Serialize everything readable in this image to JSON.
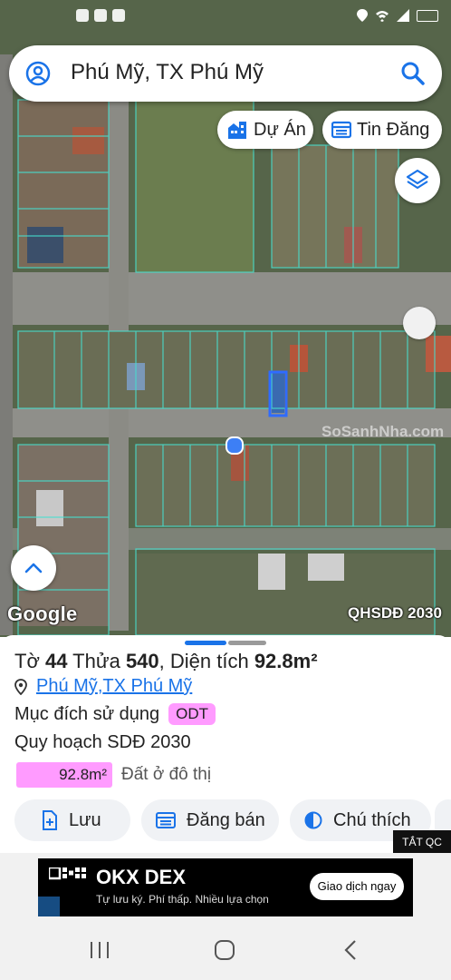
{
  "status_bar": {
    "left_icons": [
      "mail-icon",
      "instagram-icon",
      "cloud-icon",
      "dot-icon"
    ],
    "right_icons": [
      "location-icon",
      "wifi-icon",
      "signal-icon",
      "battery-icon"
    ]
  },
  "search": {
    "query": "Phú Mỹ, TX Phú Mỹ",
    "icon_left": "user-icon",
    "icon_right": "search-icon"
  },
  "chips": [
    {
      "label": "Dự Án",
      "icon": "building-icon"
    },
    {
      "label": "Tin Đăng",
      "icon": "listing-icon"
    }
  ],
  "map": {
    "brand": "Google",
    "plan_label": "QHSDĐ 2030",
    "watermark": "SoSanhNha.com"
  },
  "parcel": {
    "prefix_sheet": "Tờ ",
    "sheet_no": "44",
    "prefix_lot": " Thửa ",
    "lot_no": "540",
    "prefix_area": ", Diện tích ",
    "area": "92.8m²",
    "address_part1": "Phú Mỹ",
    "address_sep": ", ",
    "address_part2": "TX Phú Mỹ",
    "purpose_label": "Mục đích sử dụng",
    "purpose_code": "ODT",
    "plan_title": "Quy hoạch SDĐ 2030",
    "area_value": "92.8m²",
    "area_desc": "Đất ở đô thị",
    "area_color": "#ff9bff"
  },
  "actions": [
    {
      "label": "Lưu",
      "icon": "save-icon"
    },
    {
      "label": "Đăng bán",
      "icon": "post-sale-icon"
    },
    {
      "label": "Chú thích",
      "icon": "legend-icon"
    }
  ],
  "ad": {
    "close_label": "TẮT QC",
    "title": "OKX DEX",
    "subtitle": "Tự lưu ký. Phí thấp. Nhiều lựa chọn",
    "cta": "Giao dịch ngay"
  },
  "accent_color": "#1a73e8"
}
